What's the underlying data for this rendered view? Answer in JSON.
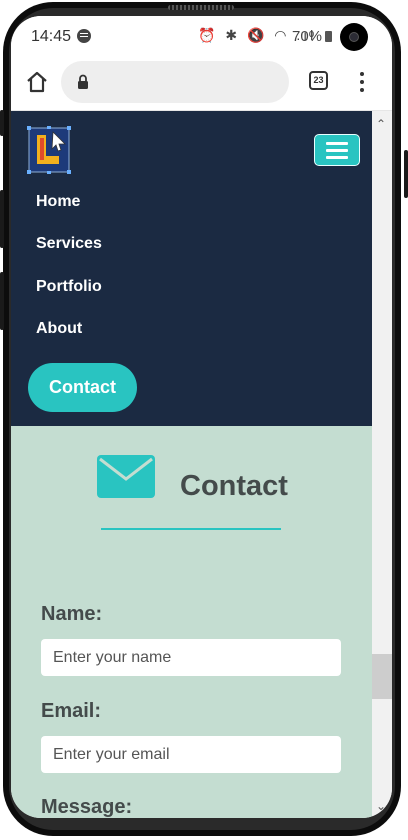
{
  "status_bar": {
    "time": "14:45",
    "icons": "⏰ ✱ 🔇 ◠ .ıl",
    "battery": "70%"
  },
  "browser": {
    "tab_count": "23"
  },
  "nav": {
    "links": [
      "Home",
      "Services",
      "Portfolio",
      "About"
    ],
    "cta": "Contact"
  },
  "contact": {
    "title": "Contact",
    "name_label": "Name:",
    "name_placeholder": "Enter your name",
    "email_label": "Email:",
    "email_placeholder": "Enter your email",
    "message_label": "Message:"
  },
  "colors": {
    "nav_bg": "#1b2a42",
    "accent": "#29c4c1",
    "section_bg": "#c4ddd1",
    "heading": "#444b4b"
  }
}
